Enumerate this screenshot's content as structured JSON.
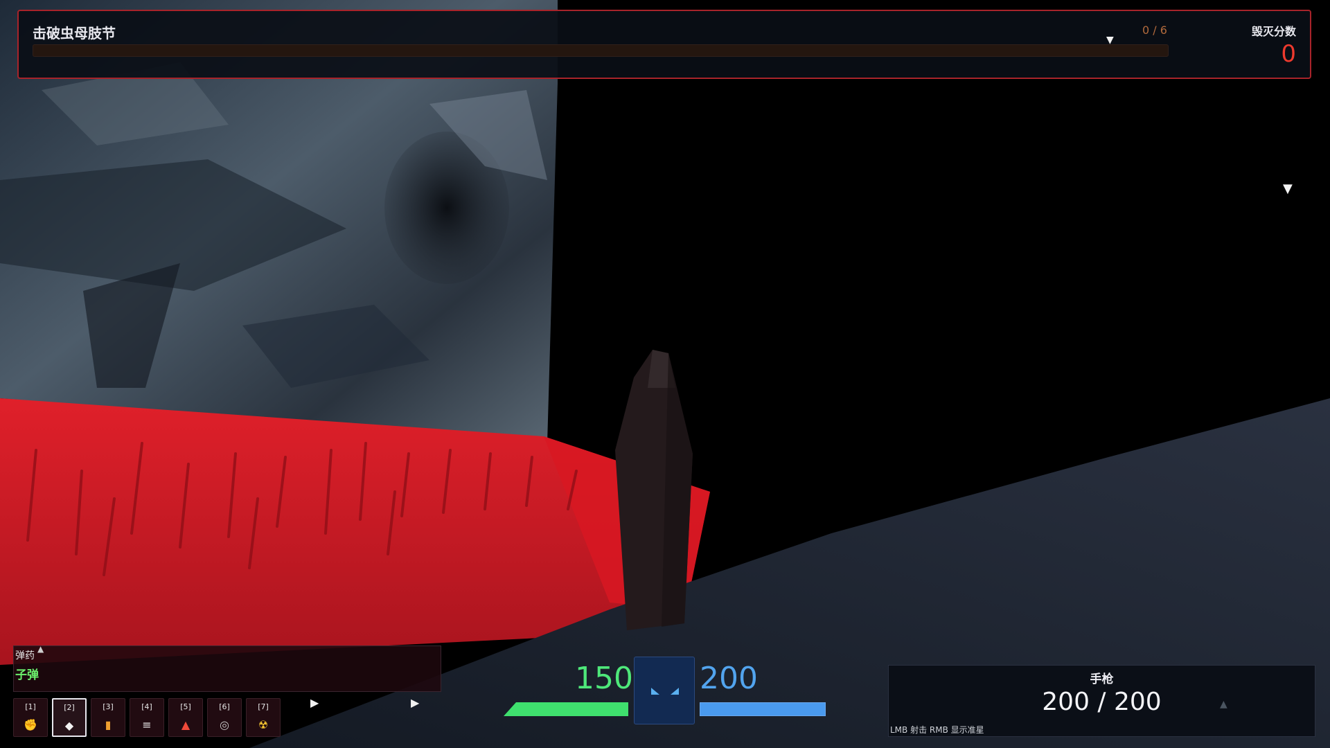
{
  "objective": {
    "title": "击破虫母肢节",
    "count": "0 / 6",
    "progress": 0,
    "marker": "▼"
  },
  "score": {
    "label": "毁灭分数",
    "value": "0"
  },
  "waypoint": {
    "glyph": "▼"
  },
  "ammo": {
    "label": "弹药",
    "caret": "▲",
    "item": "子弹",
    "arrow_left": "▶",
    "arrow_right": "▶"
  },
  "slots": [
    {
      "key": "[1]",
      "icon": "fist-icon",
      "glyph": "✊",
      "color": "#f2c230"
    },
    {
      "key": "[2]",
      "icon": "diamond-icon",
      "glyph": "◆",
      "color": "#f2f2f2"
    },
    {
      "key": "[3]",
      "icon": "battery-icon",
      "glyph": "▮",
      "color": "#f0a030"
    },
    {
      "key": "[4]",
      "icon": "lines-icon",
      "glyph": "≡",
      "color": "#f2f2f2"
    },
    {
      "key": "[5]",
      "icon": "triangle-icon",
      "glyph": "▲",
      "color": "#f04a3a"
    },
    {
      "key": "[6]",
      "icon": "target-icon",
      "glyph": "◎",
      "color": "#c8c8c8"
    },
    {
      "key": "[7]",
      "icon": "radiation-icon",
      "glyph": "☢",
      "color": "#f2c230"
    }
  ],
  "active_slot": 1,
  "health": {
    "value": "150",
    "fraction": 1.0,
    "color": "#3fe06e"
  },
  "shield": {
    "value": "200",
    "fraction": 1.0,
    "color": "#4a9aee"
  },
  "weapon": {
    "name": "手枪",
    "ammo": "200 / 200",
    "caret": "▲",
    "hint": "LMB 射击  RMB 显示准星"
  }
}
